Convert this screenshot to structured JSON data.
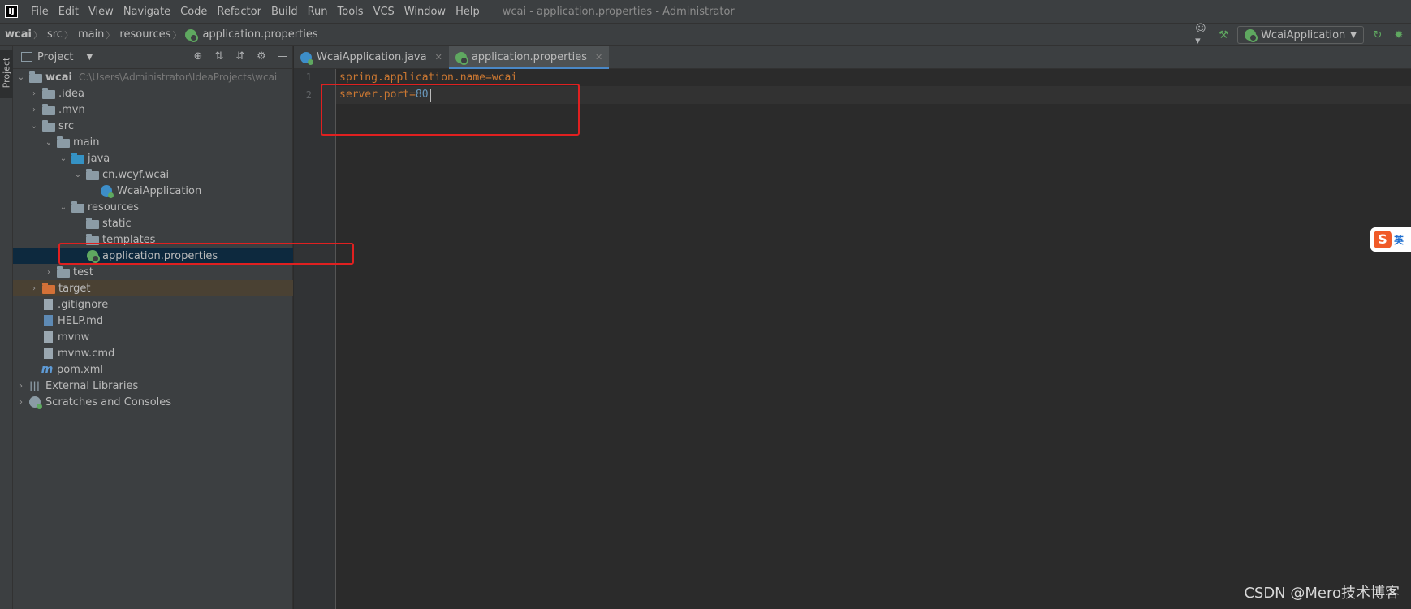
{
  "menubar": {
    "items": [
      "File",
      "Edit",
      "View",
      "Navigate",
      "Code",
      "Refactor",
      "Build",
      "Run",
      "Tools",
      "VCS",
      "Window",
      "Help"
    ],
    "window_title": "wcai - application.properties - Administrator"
  },
  "breadcrumb": [
    "wcai",
    "src",
    "main",
    "resources",
    "application.properties"
  ],
  "toolbar": {
    "run_config": "WcaiApplication"
  },
  "left_stripe": {
    "project_label": "Project"
  },
  "project_panel": {
    "title": "Project",
    "root_path": "C:\\Users\\Administrator\\IdeaProjects\\wcai",
    "tree": [
      {
        "label": "wcai",
        "depth": 0,
        "expanded": true,
        "icon": "module-folder-icon"
      },
      {
        "label": ".idea",
        "depth": 1,
        "expanded": false,
        "icon": "folder-icon"
      },
      {
        "label": ".mvn",
        "depth": 1,
        "expanded": false,
        "icon": "folder-icon"
      },
      {
        "label": "src",
        "depth": 1,
        "expanded": true,
        "icon": "folder-icon"
      },
      {
        "label": "main",
        "depth": 2,
        "expanded": true,
        "icon": "folder-icon"
      },
      {
        "label": "java",
        "depth": 3,
        "expanded": true,
        "icon": "source-folder-icon"
      },
      {
        "label": "cn.wcyf.wcai",
        "depth": 4,
        "expanded": true,
        "icon": "package-icon"
      },
      {
        "label": "WcaiApplication",
        "depth": 5,
        "icon": "spring-boot-class-icon"
      },
      {
        "label": "resources",
        "depth": 3,
        "expanded": true,
        "icon": "resources-folder-icon"
      },
      {
        "label": "static",
        "depth": 4,
        "icon": "folder-icon"
      },
      {
        "label": "templates",
        "depth": 4,
        "icon": "folder-icon"
      },
      {
        "label": "application.properties",
        "depth": 4,
        "icon": "spring-properties-icon",
        "selected": true
      },
      {
        "label": "test",
        "depth": 2,
        "expanded": false,
        "icon": "folder-icon"
      },
      {
        "label": "target",
        "depth": 1,
        "expanded": false,
        "icon": "excluded-folder-icon"
      },
      {
        "label": ".gitignore",
        "depth": 1,
        "icon": "gitignore-file-icon"
      },
      {
        "label": "HELP.md",
        "depth": 1,
        "icon": "markdown-file-icon"
      },
      {
        "label": "mvnw",
        "depth": 1,
        "icon": "shell-file-icon"
      },
      {
        "label": "mvnw.cmd",
        "depth": 1,
        "icon": "cmd-file-icon"
      },
      {
        "label": "pom.xml",
        "depth": 1,
        "icon": "maven-file-icon"
      },
      {
        "label": "External Libraries",
        "depth": 0,
        "expanded": false,
        "icon": "libraries-icon"
      },
      {
        "label": "Scratches and Consoles",
        "depth": 0,
        "expanded": false,
        "icon": "scratches-icon"
      }
    ]
  },
  "editor_tabs": [
    {
      "label": "WcaiApplication.java",
      "active": false
    },
    {
      "label": "application.properties",
      "active": true
    }
  ],
  "editor": {
    "lines": [
      {
        "num": "1",
        "key": "spring.application.name",
        "eq": "=",
        "value": "wcai"
      },
      {
        "num": "2",
        "key": "server.port",
        "eq": "=",
        "value": "80"
      }
    ]
  },
  "ime": {
    "glyph": "S",
    "text": "英"
  },
  "watermark": "CSDN @Mero技术博客",
  "colors": {
    "accent": "#4a88c7",
    "highlight_box": "#e02020",
    "selected_row": "#0d293e",
    "property_key": "#cc7832",
    "property_value_number": "#6897bb"
  }
}
